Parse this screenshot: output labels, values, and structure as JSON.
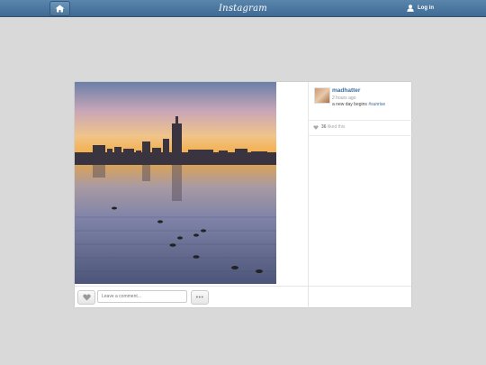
{
  "header": {
    "logo_text": "Instagram",
    "home_icon": "home-icon",
    "login_label": "Log in",
    "login_icon": "user-icon"
  },
  "post": {
    "photo_alt": "Boston skyline at sunrise over the Charles River with ducks",
    "username": "madhatter",
    "time_ago": "2 hours ago",
    "caption_text": "a new day begins ",
    "caption_tag": "#sunrise",
    "likes_count": "36",
    "likes_suffix": " liked this",
    "comment_placeholder": "Leave a comment...",
    "more_label": "•••"
  },
  "colors": {
    "topbar": "#4a76a0",
    "link": "#3b6d99",
    "background": "#d9d9d9"
  }
}
